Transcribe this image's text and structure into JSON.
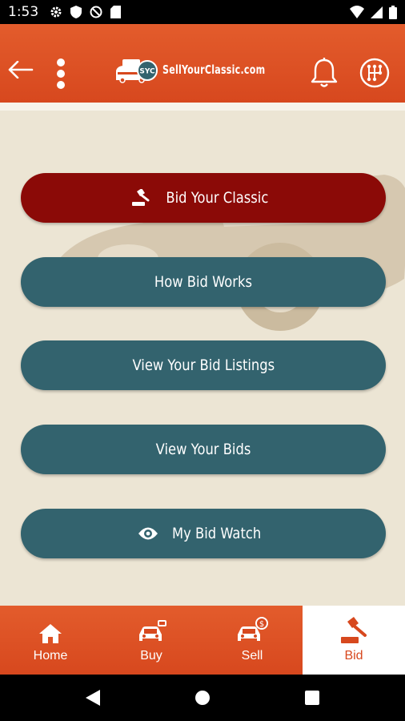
{
  "status_bar": {
    "time": "1:53"
  },
  "header": {
    "logo_text": "SellYourClassic.com",
    "logo_badge": "SYC"
  },
  "actions": {
    "bid_your_classic": "Bid Your Classic",
    "how_bid_works": "How Bid Works",
    "view_bid_listings": "View Your Bid Listings",
    "view_your_bids": "View Your Bids",
    "my_bid_watch": "My Bid Watch"
  },
  "bottom_nav": {
    "tabs": [
      {
        "label": "Home",
        "icon": "home-icon"
      },
      {
        "label": "Buy",
        "icon": "car-buy-icon"
      },
      {
        "label": "Sell",
        "icon": "car-sell-icon"
      },
      {
        "label": "Bid",
        "icon": "gavel-icon"
      }
    ],
    "active": "Bid"
  },
  "colors": {
    "brand_orange": "#d7481e",
    "primary_button": "#8b0a07",
    "secondary_button": "#33636e",
    "background": "#ece5d4"
  }
}
